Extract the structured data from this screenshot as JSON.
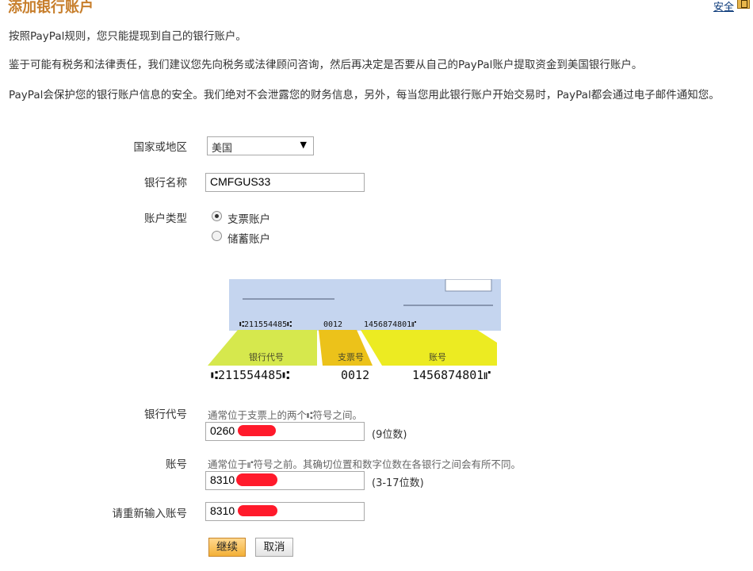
{
  "header": {
    "title": "添加银行账户",
    "security_link": "安全"
  },
  "intro": [
    "按照PayPal规则，您只能提现到自己的银行账户。",
    "鉴于可能有税务和法律责任，我们建议您先向税务或法律顾问咨询，然后再决定是否要从自己的PayPal账户提取资金到美国银行账户。",
    "PayPal会保护您的银行账户信息的安全。我们绝对不会泄露您的财务信息，另外，每当您用此银行账户开始交易时，PayPal都会通过电子邮件通知您。"
  ],
  "form": {
    "country": {
      "label": "国家或地区",
      "value": "美国"
    },
    "bank_name": {
      "label": "银行名称",
      "value": "CMFGUS33"
    },
    "account_type": {
      "label": "账户类型",
      "options": [
        "支票账户",
        "储蓄账户"
      ],
      "selected": "支票账户"
    },
    "routing": {
      "label": "银行代号",
      "hint_before": "通常位于支票上的两个",
      "hint_symbol": "⑆",
      "hint_after": "符号之间。",
      "value": "0260",
      "suffix": "(9位数)"
    },
    "account": {
      "label": "账号",
      "hint_before": "通常位于",
      "hint_symbol": "⑈",
      "hint_after": "符号之前。其确切位置和数字位数在各银行之间会有所不同。",
      "value": "8310",
      "suffix": "(3-17位数)"
    },
    "account_confirm": {
      "label": "请重新输入账号",
      "value": "8310"
    }
  },
  "check_diagram": {
    "micr_top": {
      "routing": "⑆211554485⑆",
      "check_no": "0012",
      "account": "1456874801⑈"
    },
    "callouts": {
      "routing": "银行代号",
      "check_no": "支票号",
      "account": "账号"
    },
    "micr_bottom": {
      "routing": "⑆211554485⑆",
      "check_no": "0012",
      "account": "1456874801⑈"
    },
    "colors": {
      "routing": "#d6e84d",
      "check_no": "#ecc21a",
      "account": "#eceb22",
      "check_bg": "#c5d5ef"
    }
  },
  "buttons": {
    "continue": "继续",
    "cancel": "取消"
  },
  "colors": {
    "title": "#c77e2b",
    "redaction": "#ff1a2b"
  }
}
